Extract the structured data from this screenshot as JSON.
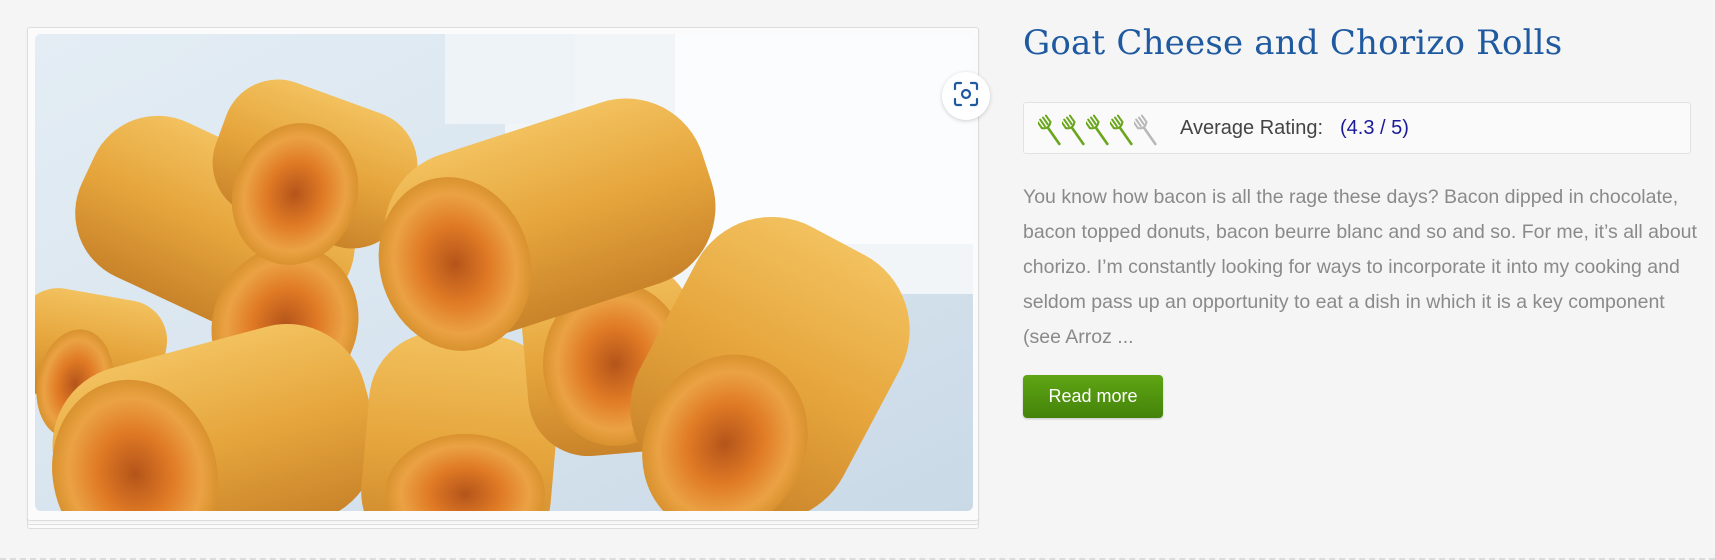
{
  "recipe": {
    "title": "Goat Cheese and Chorizo Rolls",
    "image_alt": "Goat Cheese and Chorizo Rolls",
    "lens_icon": "lens-scan-icon",
    "rating": {
      "label": "Average Rating:",
      "value_text": "(4.3 / 5)",
      "value": 4.3,
      "max": 5,
      "icon": "fork-icon",
      "filled_color": "#6aa61d",
      "empty_color": "#b8b8b8"
    },
    "description": "You know how bacon is all the rage these days? Bacon dipped in chocolate, bacon topped donuts, bacon beurre blanc and so and so. For me, it’s all about chorizo. I’m constantly looking for ways to incorporate it into my cooking and seldom pass up an opportunity to eat a dish in which it is a key component (see Arroz ...",
    "read_more_label": "Read more"
  },
  "colors": {
    "title": "#1f5aa0",
    "button": "#4f9510",
    "description": "#8a8a8a"
  }
}
